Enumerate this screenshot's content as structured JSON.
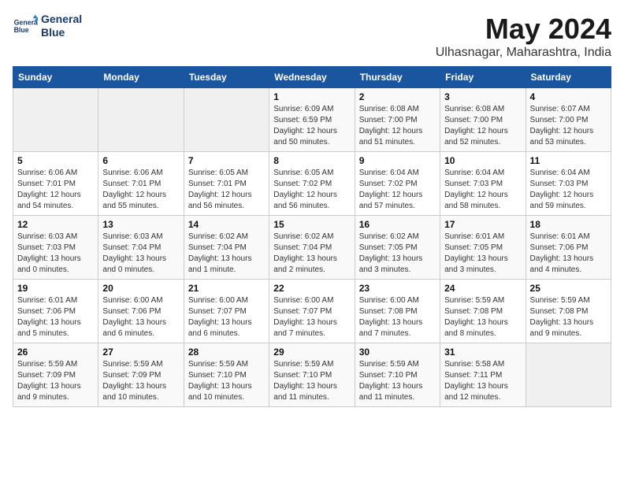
{
  "logo": {
    "line1": "General",
    "line2": "Blue"
  },
  "title": "May 2024",
  "location": "Ulhasnagar, Maharashtra, India",
  "weekdays": [
    "Sunday",
    "Monday",
    "Tuesday",
    "Wednesday",
    "Thursday",
    "Friday",
    "Saturday"
  ],
  "weeks": [
    [
      {
        "day": "",
        "sunrise": "",
        "sunset": "",
        "daylight": ""
      },
      {
        "day": "",
        "sunrise": "",
        "sunset": "",
        "daylight": ""
      },
      {
        "day": "",
        "sunrise": "",
        "sunset": "",
        "daylight": ""
      },
      {
        "day": "1",
        "sunrise": "Sunrise: 6:09 AM",
        "sunset": "Sunset: 6:59 PM",
        "daylight": "Daylight: 12 hours and 50 minutes."
      },
      {
        "day": "2",
        "sunrise": "Sunrise: 6:08 AM",
        "sunset": "Sunset: 7:00 PM",
        "daylight": "Daylight: 12 hours and 51 minutes."
      },
      {
        "day": "3",
        "sunrise": "Sunrise: 6:08 AM",
        "sunset": "Sunset: 7:00 PM",
        "daylight": "Daylight: 12 hours and 52 minutes."
      },
      {
        "day": "4",
        "sunrise": "Sunrise: 6:07 AM",
        "sunset": "Sunset: 7:00 PM",
        "daylight": "Daylight: 12 hours and 53 minutes."
      }
    ],
    [
      {
        "day": "5",
        "sunrise": "Sunrise: 6:06 AM",
        "sunset": "Sunset: 7:01 PM",
        "daylight": "Daylight: 12 hours and 54 minutes."
      },
      {
        "day": "6",
        "sunrise": "Sunrise: 6:06 AM",
        "sunset": "Sunset: 7:01 PM",
        "daylight": "Daylight: 12 hours and 55 minutes."
      },
      {
        "day": "7",
        "sunrise": "Sunrise: 6:05 AM",
        "sunset": "Sunset: 7:01 PM",
        "daylight": "Daylight: 12 hours and 56 minutes."
      },
      {
        "day": "8",
        "sunrise": "Sunrise: 6:05 AM",
        "sunset": "Sunset: 7:02 PM",
        "daylight": "Daylight: 12 hours and 56 minutes."
      },
      {
        "day": "9",
        "sunrise": "Sunrise: 6:04 AM",
        "sunset": "Sunset: 7:02 PM",
        "daylight": "Daylight: 12 hours and 57 minutes."
      },
      {
        "day": "10",
        "sunrise": "Sunrise: 6:04 AM",
        "sunset": "Sunset: 7:03 PM",
        "daylight": "Daylight: 12 hours and 58 minutes."
      },
      {
        "day": "11",
        "sunrise": "Sunrise: 6:04 AM",
        "sunset": "Sunset: 7:03 PM",
        "daylight": "Daylight: 12 hours and 59 minutes."
      }
    ],
    [
      {
        "day": "12",
        "sunrise": "Sunrise: 6:03 AM",
        "sunset": "Sunset: 7:03 PM",
        "daylight": "Daylight: 13 hours and 0 minutes."
      },
      {
        "day": "13",
        "sunrise": "Sunrise: 6:03 AM",
        "sunset": "Sunset: 7:04 PM",
        "daylight": "Daylight: 13 hours and 0 minutes."
      },
      {
        "day": "14",
        "sunrise": "Sunrise: 6:02 AM",
        "sunset": "Sunset: 7:04 PM",
        "daylight": "Daylight: 13 hours and 1 minute."
      },
      {
        "day": "15",
        "sunrise": "Sunrise: 6:02 AM",
        "sunset": "Sunset: 7:04 PM",
        "daylight": "Daylight: 13 hours and 2 minutes."
      },
      {
        "day": "16",
        "sunrise": "Sunrise: 6:02 AM",
        "sunset": "Sunset: 7:05 PM",
        "daylight": "Daylight: 13 hours and 3 minutes."
      },
      {
        "day": "17",
        "sunrise": "Sunrise: 6:01 AM",
        "sunset": "Sunset: 7:05 PM",
        "daylight": "Daylight: 13 hours and 3 minutes."
      },
      {
        "day": "18",
        "sunrise": "Sunrise: 6:01 AM",
        "sunset": "Sunset: 7:06 PM",
        "daylight": "Daylight: 13 hours and 4 minutes."
      }
    ],
    [
      {
        "day": "19",
        "sunrise": "Sunrise: 6:01 AM",
        "sunset": "Sunset: 7:06 PM",
        "daylight": "Daylight: 13 hours and 5 minutes."
      },
      {
        "day": "20",
        "sunrise": "Sunrise: 6:00 AM",
        "sunset": "Sunset: 7:06 PM",
        "daylight": "Daylight: 13 hours and 6 minutes."
      },
      {
        "day": "21",
        "sunrise": "Sunrise: 6:00 AM",
        "sunset": "Sunset: 7:07 PM",
        "daylight": "Daylight: 13 hours and 6 minutes."
      },
      {
        "day": "22",
        "sunrise": "Sunrise: 6:00 AM",
        "sunset": "Sunset: 7:07 PM",
        "daylight": "Daylight: 13 hours and 7 minutes."
      },
      {
        "day": "23",
        "sunrise": "Sunrise: 6:00 AM",
        "sunset": "Sunset: 7:08 PM",
        "daylight": "Daylight: 13 hours and 7 minutes."
      },
      {
        "day": "24",
        "sunrise": "Sunrise: 5:59 AM",
        "sunset": "Sunset: 7:08 PM",
        "daylight": "Daylight: 13 hours and 8 minutes."
      },
      {
        "day": "25",
        "sunrise": "Sunrise: 5:59 AM",
        "sunset": "Sunset: 7:08 PM",
        "daylight": "Daylight: 13 hours and 9 minutes."
      }
    ],
    [
      {
        "day": "26",
        "sunrise": "Sunrise: 5:59 AM",
        "sunset": "Sunset: 7:09 PM",
        "daylight": "Daylight: 13 hours and 9 minutes."
      },
      {
        "day": "27",
        "sunrise": "Sunrise: 5:59 AM",
        "sunset": "Sunset: 7:09 PM",
        "daylight": "Daylight: 13 hours and 10 minutes."
      },
      {
        "day": "28",
        "sunrise": "Sunrise: 5:59 AM",
        "sunset": "Sunset: 7:10 PM",
        "daylight": "Daylight: 13 hours and 10 minutes."
      },
      {
        "day": "29",
        "sunrise": "Sunrise: 5:59 AM",
        "sunset": "Sunset: 7:10 PM",
        "daylight": "Daylight: 13 hours and 11 minutes."
      },
      {
        "day": "30",
        "sunrise": "Sunrise: 5:59 AM",
        "sunset": "Sunset: 7:10 PM",
        "daylight": "Daylight: 13 hours and 11 minutes."
      },
      {
        "day": "31",
        "sunrise": "Sunrise: 5:58 AM",
        "sunset": "Sunset: 7:11 PM",
        "daylight": "Daylight: 13 hours and 12 minutes."
      },
      {
        "day": "",
        "sunrise": "",
        "sunset": "",
        "daylight": ""
      }
    ]
  ]
}
